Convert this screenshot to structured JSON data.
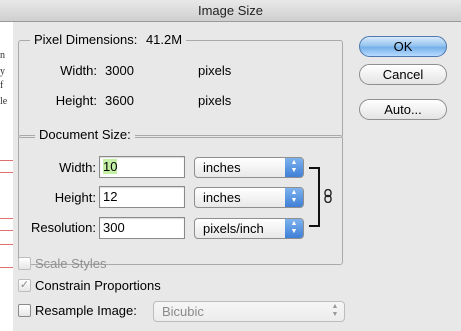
{
  "window": {
    "title": "Image Size"
  },
  "background_doc": {
    "fragments": [
      "n",
      "y",
      "f",
      "le"
    ]
  },
  "pixel_dimensions": {
    "legend": "Pixel Dimensions:",
    "size": "41.2M",
    "width_label": "Width:",
    "width_value": "3000",
    "width_unit": "pixels",
    "height_label": "Height:",
    "height_value": "3600",
    "height_unit": "pixels"
  },
  "document_size": {
    "legend": "Document Size:",
    "width_label": "Width:",
    "width_value": "10",
    "width_unit": "inches",
    "height_label": "Height:",
    "height_value": "12",
    "height_unit": "inches",
    "resolution_label": "Resolution:",
    "resolution_value": "300",
    "resolution_unit": "pixels/inch"
  },
  "buttons": {
    "ok": "OK",
    "cancel": "Cancel",
    "auto": "Auto..."
  },
  "options": {
    "scale_styles": {
      "label": "Scale Styles",
      "checked": false,
      "enabled": false
    },
    "constrain_proportions": {
      "label": "Constrain Proportions",
      "checked": true,
      "enabled": false
    },
    "resample_image": {
      "label": "Resample Image:",
      "checked": false,
      "enabled": true
    },
    "resample_method": "Bicubic"
  },
  "colors": {
    "default_button": "#72aee8",
    "selection_highlight": "#c4f0a6",
    "popup_arrows": "#3f7fd6"
  },
  "icons": {
    "link": "chain-link-icon",
    "popup": "up-down-arrows-icon",
    "check": "checkmark-icon"
  }
}
